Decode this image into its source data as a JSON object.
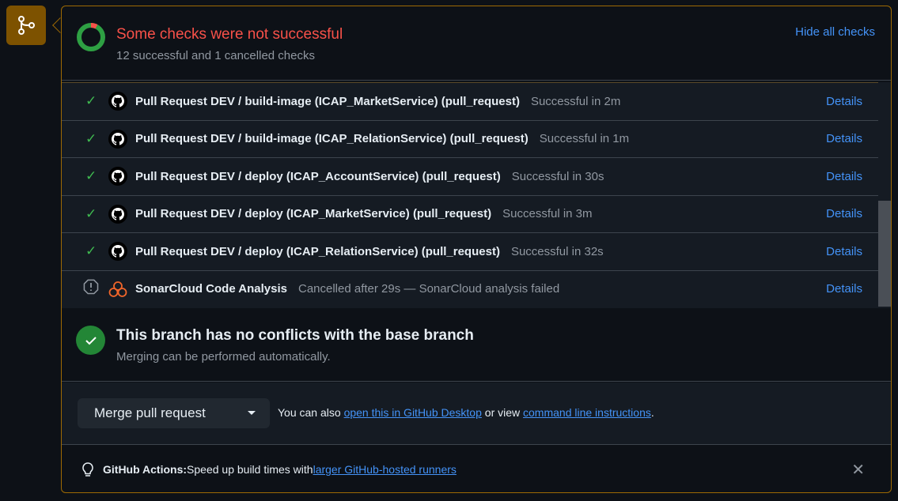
{
  "header": {
    "title": "Some checks were not successful",
    "summary": "12 successful and 1 cancelled checks",
    "hide_label": "Hide all checks"
  },
  "checks": [
    {
      "name": "Pull Request DEV / build-image (ICAP_MarketService) (pull_request)",
      "status": "Successful in 2m",
      "link": "Details",
      "state": "success",
      "icon": "github-icon"
    },
    {
      "name": "Pull Request DEV / build-image (ICAP_RelationService) (pull_request)",
      "status": "Successful in 1m",
      "link": "Details",
      "state": "success",
      "icon": "github-icon"
    },
    {
      "name": "Pull Request DEV / deploy (ICAP_AccountService) (pull_request)",
      "status": "Successful in 30s",
      "link": "Details",
      "state": "success",
      "icon": "github-icon"
    },
    {
      "name": "Pull Request DEV / deploy (ICAP_MarketService) (pull_request)",
      "status": "Successful in 3m",
      "link": "Details",
      "state": "success",
      "icon": "github-icon"
    },
    {
      "name": "Pull Request DEV / deploy (ICAP_RelationService) (pull_request)",
      "status": "Successful in 32s",
      "link": "Details",
      "state": "success",
      "icon": "github-icon"
    },
    {
      "name": "SonarCloud Code Analysis",
      "status": "Cancelled after 29s — SonarCloud analysis failed",
      "link": "Details",
      "state": "cancelled",
      "icon": "sonarcloud-icon"
    }
  ],
  "branch": {
    "title": "This branch has no conflicts with the base branch",
    "subtitle": "Merging can be performed automatically."
  },
  "merge": {
    "button": "Merge pull request",
    "also_prefix": "You can also ",
    "desktop_link": "open this in GitHub Desktop",
    "or_view": " or view ",
    "cli_link": "command line instructions",
    "period": "."
  },
  "tip": {
    "label": "GitHub Actions:",
    "text": " Speed up build times with ",
    "link": "larger GitHub-hosted runners"
  },
  "colors": {
    "accent": "#4493f8",
    "error": "#f85149",
    "success": "#3fb950",
    "border": "#9e6a03"
  }
}
